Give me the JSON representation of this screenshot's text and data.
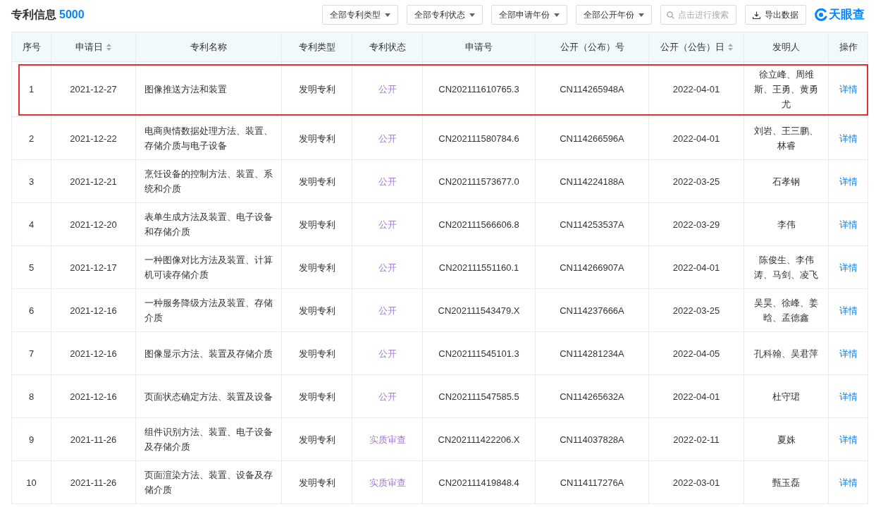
{
  "title": "专利信息",
  "count": "5000",
  "filters": [
    "全部专利类型",
    "全部专利状态",
    "全部申请年份",
    "全部公开年份"
  ],
  "search": {
    "placeholder": "点击进行搜索"
  },
  "export_button": "导出数据",
  "logo": "天眼查",
  "table": {
    "columns": [
      {
        "label": "序号",
        "sortable": false
      },
      {
        "label": "申请日",
        "sortable": true
      },
      {
        "label": "专利名称",
        "sortable": false
      },
      {
        "label": "专利类型",
        "sortable": false
      },
      {
        "label": "专利状态",
        "sortable": false
      },
      {
        "label": "申请号",
        "sortable": false
      },
      {
        "label": "公开（公布）号",
        "sortable": false
      },
      {
        "label": "公开（公告）日",
        "sortable": true
      },
      {
        "label": "发明人",
        "sortable": false
      },
      {
        "label": "操作",
        "sortable": false
      }
    ],
    "rows": [
      {
        "highlighted": true,
        "no": "1",
        "date": "2021-12-27",
        "name": "图像推送方法和装置",
        "type": "发明专利",
        "status": "公开",
        "app_no": "CN202111610765.3",
        "pub_no": "CN114265948A",
        "pub_date": "2022-04-01",
        "inventors": "徐立峰、周维斯、王勇、黄勇尤",
        "action": "详情"
      },
      {
        "highlighted": false,
        "no": "2",
        "date": "2021-12-22",
        "name": "电商舆情数据处理方法、装置、存储介质与电子设备",
        "type": "发明专利",
        "status": "公开",
        "app_no": "CN202111580784.6",
        "pub_no": "CN114266596A",
        "pub_date": "2022-04-01",
        "inventors": "刘岩、王三鹏、林睿",
        "action": "详情"
      },
      {
        "highlighted": false,
        "no": "3",
        "date": "2021-12-21",
        "name": "烹饪设备的控制方法、装置、系统和介质",
        "type": "发明专利",
        "status": "公开",
        "app_no": "CN202111573677.0",
        "pub_no": "CN114224188A",
        "pub_date": "2022-03-25",
        "inventors": "石孝钢",
        "action": "详情"
      },
      {
        "highlighted": false,
        "no": "4",
        "date": "2021-12-20",
        "name": "表单生成方法及装置、电子设备和存储介质",
        "type": "发明专利",
        "status": "公开",
        "app_no": "CN202111566606.8",
        "pub_no": "CN114253537A",
        "pub_date": "2022-03-29",
        "inventors": "李伟",
        "action": "详情"
      },
      {
        "highlighted": false,
        "no": "5",
        "date": "2021-12-17",
        "name": "一种图像对比方法及装置、计算机可读存储介质",
        "type": "发明专利",
        "status": "公开",
        "app_no": "CN202111551160.1",
        "pub_no": "CN114266907A",
        "pub_date": "2022-04-01",
        "inventors": "陈俊生、李伟涛、马剑、凌飞",
        "action": "详情"
      },
      {
        "highlighted": false,
        "no": "6",
        "date": "2021-12-16",
        "name": "一种服务降级方法及装置、存储介质",
        "type": "发明专利",
        "status": "公开",
        "app_no": "CN202111543479.X",
        "pub_no": "CN114237666A",
        "pub_date": "2022-03-25",
        "inventors": "吴昊、徐峰、姜晗、孟德鑫",
        "action": "详情"
      },
      {
        "highlighted": false,
        "no": "7",
        "date": "2021-12-16",
        "name": "图像显示方法、装置及存储介质",
        "type": "发明专利",
        "status": "公开",
        "app_no": "CN202111545101.3",
        "pub_no": "CN114281234A",
        "pub_date": "2022-04-05",
        "inventors": "孔科翰、吴君萍",
        "action": "详情"
      },
      {
        "highlighted": false,
        "no": "8",
        "date": "2021-12-16",
        "name": "页面状态确定方法、装置及设备",
        "type": "发明专利",
        "status": "公开",
        "app_no": "CN202111547585.5",
        "pub_no": "CN114265632A",
        "pub_date": "2022-04-01",
        "inventors": "杜守珺",
        "action": "详情"
      },
      {
        "highlighted": false,
        "no": "9",
        "date": "2021-11-26",
        "name": "组件识别方法、装置、电子设备及存储介质",
        "type": "发明专利",
        "status": "实质审查",
        "app_no": "CN202111422206.X",
        "pub_no": "CN114037828A",
        "pub_date": "2022-02-11",
        "inventors": "夏姝",
        "action": "详情"
      },
      {
        "highlighted": false,
        "no": "10",
        "date": "2021-11-26",
        "name": "页面渲染方法、装置、设备及存储介质",
        "type": "发明专利",
        "status": "实质审查",
        "app_no": "CN202111419848.4",
        "pub_no": "CN114117276A",
        "pub_date": "2022-03-01",
        "inventors": "甄玉磊",
        "action": "详情"
      }
    ]
  }
}
